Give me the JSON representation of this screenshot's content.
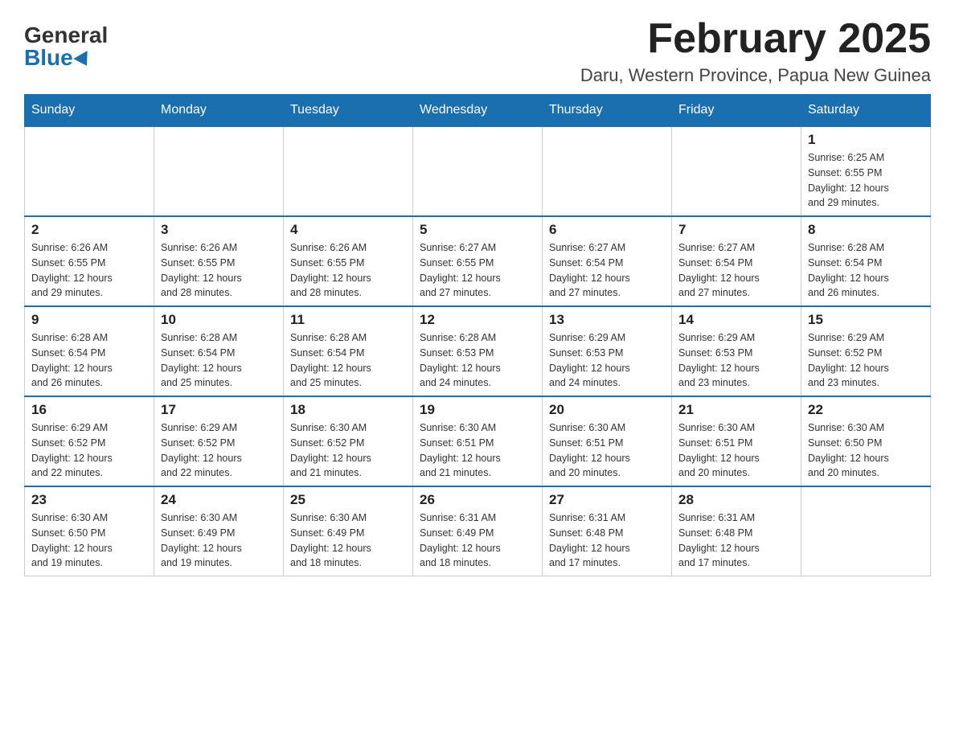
{
  "logo": {
    "general": "General",
    "blue": "Blue"
  },
  "title": "February 2025",
  "location": "Daru, Western Province, Papua New Guinea",
  "weekdays": [
    "Sunday",
    "Monday",
    "Tuesday",
    "Wednesday",
    "Thursday",
    "Friday",
    "Saturday"
  ],
  "weeks": [
    [
      {
        "day": "",
        "info": ""
      },
      {
        "day": "",
        "info": ""
      },
      {
        "day": "",
        "info": ""
      },
      {
        "day": "",
        "info": ""
      },
      {
        "day": "",
        "info": ""
      },
      {
        "day": "",
        "info": ""
      },
      {
        "day": "1",
        "info": "Sunrise: 6:25 AM\nSunset: 6:55 PM\nDaylight: 12 hours\nand 29 minutes."
      }
    ],
    [
      {
        "day": "2",
        "info": "Sunrise: 6:26 AM\nSunset: 6:55 PM\nDaylight: 12 hours\nand 29 minutes."
      },
      {
        "day": "3",
        "info": "Sunrise: 6:26 AM\nSunset: 6:55 PM\nDaylight: 12 hours\nand 28 minutes."
      },
      {
        "day": "4",
        "info": "Sunrise: 6:26 AM\nSunset: 6:55 PM\nDaylight: 12 hours\nand 28 minutes."
      },
      {
        "day": "5",
        "info": "Sunrise: 6:27 AM\nSunset: 6:55 PM\nDaylight: 12 hours\nand 27 minutes."
      },
      {
        "day": "6",
        "info": "Sunrise: 6:27 AM\nSunset: 6:54 PM\nDaylight: 12 hours\nand 27 minutes."
      },
      {
        "day": "7",
        "info": "Sunrise: 6:27 AM\nSunset: 6:54 PM\nDaylight: 12 hours\nand 27 minutes."
      },
      {
        "day": "8",
        "info": "Sunrise: 6:28 AM\nSunset: 6:54 PM\nDaylight: 12 hours\nand 26 minutes."
      }
    ],
    [
      {
        "day": "9",
        "info": "Sunrise: 6:28 AM\nSunset: 6:54 PM\nDaylight: 12 hours\nand 26 minutes."
      },
      {
        "day": "10",
        "info": "Sunrise: 6:28 AM\nSunset: 6:54 PM\nDaylight: 12 hours\nand 25 minutes."
      },
      {
        "day": "11",
        "info": "Sunrise: 6:28 AM\nSunset: 6:54 PM\nDaylight: 12 hours\nand 25 minutes."
      },
      {
        "day": "12",
        "info": "Sunrise: 6:28 AM\nSunset: 6:53 PM\nDaylight: 12 hours\nand 24 minutes."
      },
      {
        "day": "13",
        "info": "Sunrise: 6:29 AM\nSunset: 6:53 PM\nDaylight: 12 hours\nand 24 minutes."
      },
      {
        "day": "14",
        "info": "Sunrise: 6:29 AM\nSunset: 6:53 PM\nDaylight: 12 hours\nand 23 minutes."
      },
      {
        "day": "15",
        "info": "Sunrise: 6:29 AM\nSunset: 6:52 PM\nDaylight: 12 hours\nand 23 minutes."
      }
    ],
    [
      {
        "day": "16",
        "info": "Sunrise: 6:29 AM\nSunset: 6:52 PM\nDaylight: 12 hours\nand 22 minutes."
      },
      {
        "day": "17",
        "info": "Sunrise: 6:29 AM\nSunset: 6:52 PM\nDaylight: 12 hours\nand 22 minutes."
      },
      {
        "day": "18",
        "info": "Sunrise: 6:30 AM\nSunset: 6:52 PM\nDaylight: 12 hours\nand 21 minutes."
      },
      {
        "day": "19",
        "info": "Sunrise: 6:30 AM\nSunset: 6:51 PM\nDaylight: 12 hours\nand 21 minutes."
      },
      {
        "day": "20",
        "info": "Sunrise: 6:30 AM\nSunset: 6:51 PM\nDaylight: 12 hours\nand 20 minutes."
      },
      {
        "day": "21",
        "info": "Sunrise: 6:30 AM\nSunset: 6:51 PM\nDaylight: 12 hours\nand 20 minutes."
      },
      {
        "day": "22",
        "info": "Sunrise: 6:30 AM\nSunset: 6:50 PM\nDaylight: 12 hours\nand 20 minutes."
      }
    ],
    [
      {
        "day": "23",
        "info": "Sunrise: 6:30 AM\nSunset: 6:50 PM\nDaylight: 12 hours\nand 19 minutes."
      },
      {
        "day": "24",
        "info": "Sunrise: 6:30 AM\nSunset: 6:49 PM\nDaylight: 12 hours\nand 19 minutes."
      },
      {
        "day": "25",
        "info": "Sunrise: 6:30 AM\nSunset: 6:49 PM\nDaylight: 12 hours\nand 18 minutes."
      },
      {
        "day": "26",
        "info": "Sunrise: 6:31 AM\nSunset: 6:49 PM\nDaylight: 12 hours\nand 18 minutes."
      },
      {
        "day": "27",
        "info": "Sunrise: 6:31 AM\nSunset: 6:48 PM\nDaylight: 12 hours\nand 17 minutes."
      },
      {
        "day": "28",
        "info": "Sunrise: 6:31 AM\nSunset: 6:48 PM\nDaylight: 12 hours\nand 17 minutes."
      },
      {
        "day": "",
        "info": ""
      }
    ]
  ]
}
